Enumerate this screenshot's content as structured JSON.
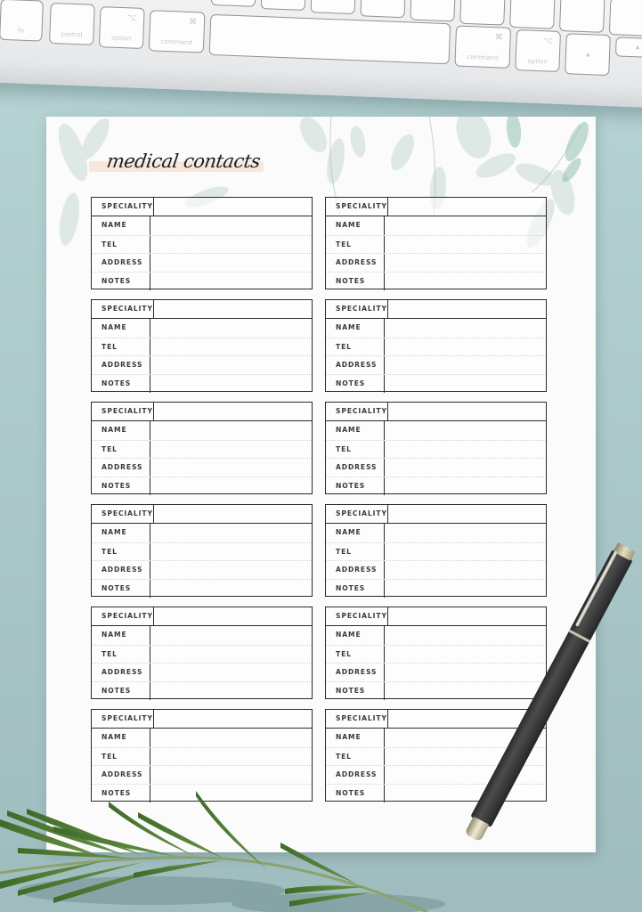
{
  "scene": {
    "description": "Printable medical contacts planner page on a desk",
    "colors": {
      "desk": "#acc9cb",
      "paper": "#fbfbfb",
      "table_border": "#2b2b2b",
      "label_text": "#3a3a3a",
      "title_highlight": "#f7e4d6",
      "leaf": "#9fbfb6",
      "rosemary": "#4f7a35",
      "pen_body": "#3b3c3d",
      "pen_trim": "#e4dfbf"
    }
  },
  "keyboard": {
    "keys": [
      {
        "label": "fn",
        "symbol": ""
      },
      {
        "label": "control",
        "symbol": ""
      },
      {
        "label": "option",
        "symbol": "⌥"
      },
      {
        "label": "command",
        "symbol": "⌘"
      },
      {
        "label": "",
        "symbol": ""
      },
      {
        "label": "command",
        "symbol": "⌘"
      },
      {
        "label": "option",
        "symbol": "⌥"
      },
      {
        "label": "",
        "symbol": "◂"
      },
      {
        "label": "",
        "symbol": "▴"
      }
    ]
  },
  "page": {
    "title": "medical contacts",
    "field_labels": [
      "SPECIALITY",
      "NAME",
      "TEL",
      "ADDRESS",
      "NOTES"
    ],
    "cards": [
      {
        "column": "left",
        "row": 1,
        "values": [
          "",
          "",
          "",
          "",
          ""
        ]
      },
      {
        "column": "right",
        "row": 1,
        "values": [
          "",
          "",
          "",
          "",
          ""
        ]
      },
      {
        "column": "left",
        "row": 2,
        "values": [
          "",
          "",
          "",
          "",
          ""
        ]
      },
      {
        "column": "right",
        "row": 2,
        "values": [
          "",
          "",
          "",
          "",
          ""
        ]
      },
      {
        "column": "left",
        "row": 3,
        "values": [
          "",
          "",
          "",
          "",
          ""
        ]
      },
      {
        "column": "right",
        "row": 3,
        "values": [
          "",
          "",
          "",
          "",
          ""
        ]
      },
      {
        "column": "left",
        "row": 4,
        "values": [
          "",
          "",
          "",
          "",
          ""
        ]
      },
      {
        "column": "right",
        "row": 4,
        "values": [
          "",
          "",
          "",
          "",
          ""
        ]
      },
      {
        "column": "left",
        "row": 5,
        "values": [
          "",
          "",
          "",
          "",
          ""
        ]
      },
      {
        "column": "right",
        "row": 5,
        "values": [
          "",
          "",
          "",
          "",
          ""
        ]
      },
      {
        "column": "left",
        "row": 6,
        "values": [
          "",
          "",
          "",
          "",
          ""
        ]
      },
      {
        "column": "right",
        "row": 6,
        "values": [
          "",
          "",
          "",
          "",
          ""
        ]
      }
    ]
  }
}
